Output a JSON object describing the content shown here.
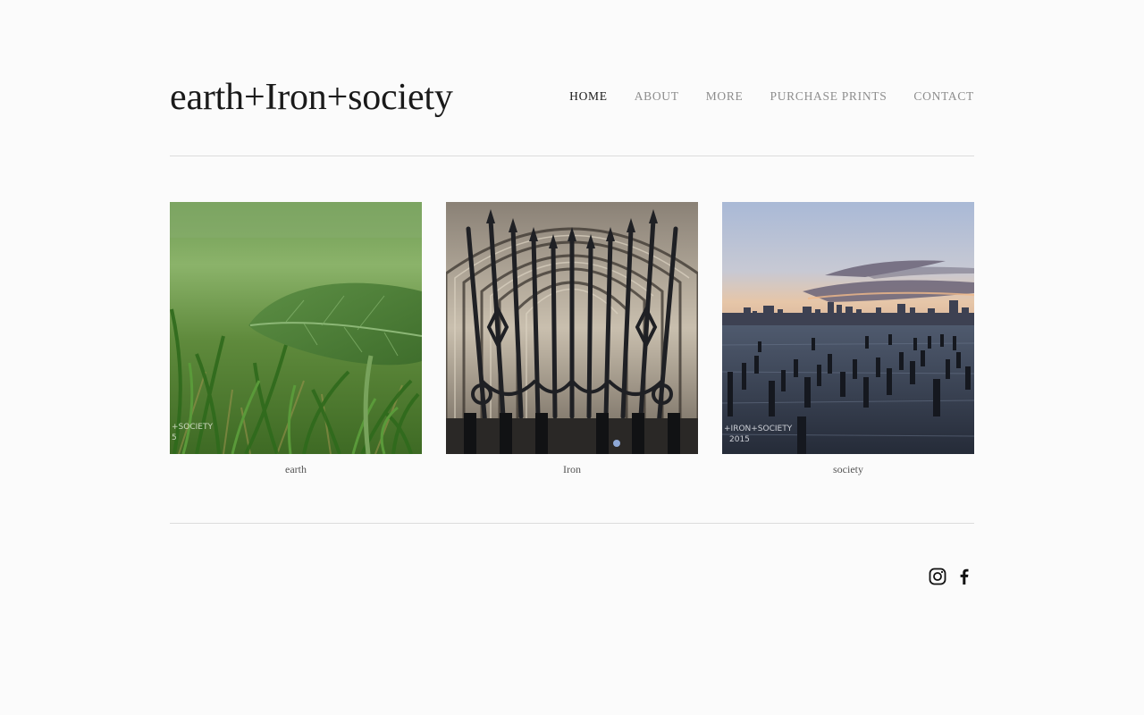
{
  "site": {
    "title": "earth+Iron+society"
  },
  "nav": {
    "items": [
      {
        "label": "HOME",
        "active": true
      },
      {
        "label": "ABOUT",
        "active": false
      },
      {
        "label": "MORE",
        "active": false
      },
      {
        "label": "PURCHASE PRINTS",
        "active": false
      },
      {
        "label": "CONTACT",
        "active": false
      }
    ]
  },
  "gallery": {
    "items": [
      {
        "caption": "earth",
        "image": "grass-leaf-photo",
        "watermark": "+SOCIETY 5"
      },
      {
        "caption": "Iron",
        "image": "iron-gothic-gate-photo"
      },
      {
        "caption": "society",
        "image": "city-skyline-pier-pilings-photo",
        "watermark": "+IRON+SOCIETY 2015"
      }
    ]
  },
  "footer": {
    "social": [
      {
        "icon": "instagram-icon"
      },
      {
        "icon": "facebook-icon"
      }
    ]
  },
  "colors": {
    "background": "#fbfbfb",
    "nav_active": "#1a1a1a",
    "nav_inactive": "#8d8d8d",
    "rule": "#dcdcdc"
  }
}
